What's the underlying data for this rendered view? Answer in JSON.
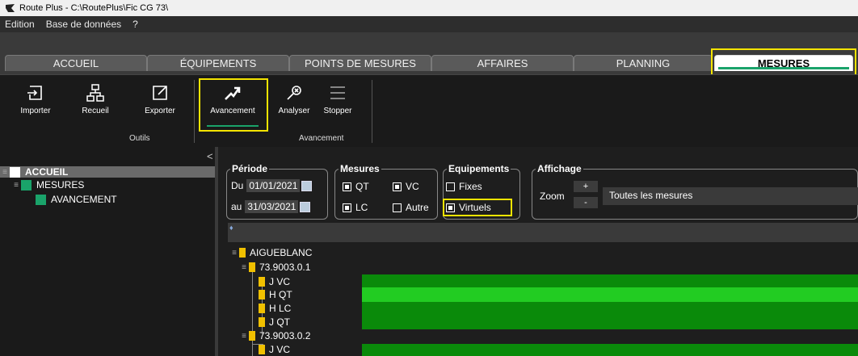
{
  "window": {
    "title": "Route Plus - C:\\RoutePlus\\Fic CG 73\\"
  },
  "menu": [
    "Edition",
    "Base de données",
    "?"
  ],
  "tabs": [
    {
      "label": "ACCUEIL"
    },
    {
      "label": "ÉQUIPEMENTS"
    },
    {
      "label": "POINTS DE MESURES"
    },
    {
      "label": "AFFAIRES"
    },
    {
      "label": "PLANNING"
    },
    {
      "label": "MESURES",
      "active": true
    }
  ],
  "ribbon": {
    "buttons": [
      {
        "label": "Importer",
        "icon": "import-icon"
      },
      {
        "label": "Recueil",
        "icon": "network-icon"
      },
      {
        "label": "Exporter",
        "icon": "export-icon"
      },
      {
        "label": "Avancement",
        "icon": "trend-arrow-icon",
        "selected": true
      },
      {
        "label": "Analyser",
        "icon": "analyse-icon"
      },
      {
        "label": "Stopper",
        "icon": "hamburger-icon"
      }
    ],
    "groups": [
      "Outils",
      "Avancement"
    ]
  },
  "tree": {
    "root": "ACCUEIL",
    "child": "MESURES",
    "leaf": "AVANCEMENT"
  },
  "filters": {
    "periode": {
      "legend": "Période",
      "from_label": "Du",
      "from": "01/01/2021",
      "to_label": "au",
      "to": "31/03/2021"
    },
    "mesures": {
      "legend": "Mesures",
      "items": [
        {
          "label": "QT",
          "checked": true
        },
        {
          "label": "VC",
          "checked": true
        },
        {
          "label": "LC",
          "checked": true
        },
        {
          "label": "Autre",
          "checked": false
        }
      ]
    },
    "equipements": {
      "legend": "Equipements",
      "fixes": "Fixes",
      "virtuels": "Virtuels",
      "fixes_checked": false,
      "virtuels_checked": true
    },
    "affichage": {
      "legend": "Affichage",
      "zoom_label": "Zoom",
      "plus": "+",
      "minus": "-",
      "selection": "Toutes les mesures"
    }
  },
  "grid": {
    "rows": [
      {
        "label": "AIGUEBLANC",
        "level": 0
      },
      {
        "label": "73.9003.0.1",
        "level": 1
      },
      {
        "label": "J VC",
        "level": 2
      },
      {
        "label": "H QT",
        "level": 2
      },
      {
        "label": "H LC",
        "level": 2
      },
      {
        "label": "J QT",
        "level": 2
      },
      {
        "label": "73.9003.0.2",
        "level": 1
      },
      {
        "label": "J VC",
        "level": 2
      }
    ]
  },
  "colors": {
    "accent_green": "#1aa36a",
    "bar_dark": "#0a8a0a",
    "bar_light": "#22cc22",
    "highlight": "#f4e400"
  }
}
